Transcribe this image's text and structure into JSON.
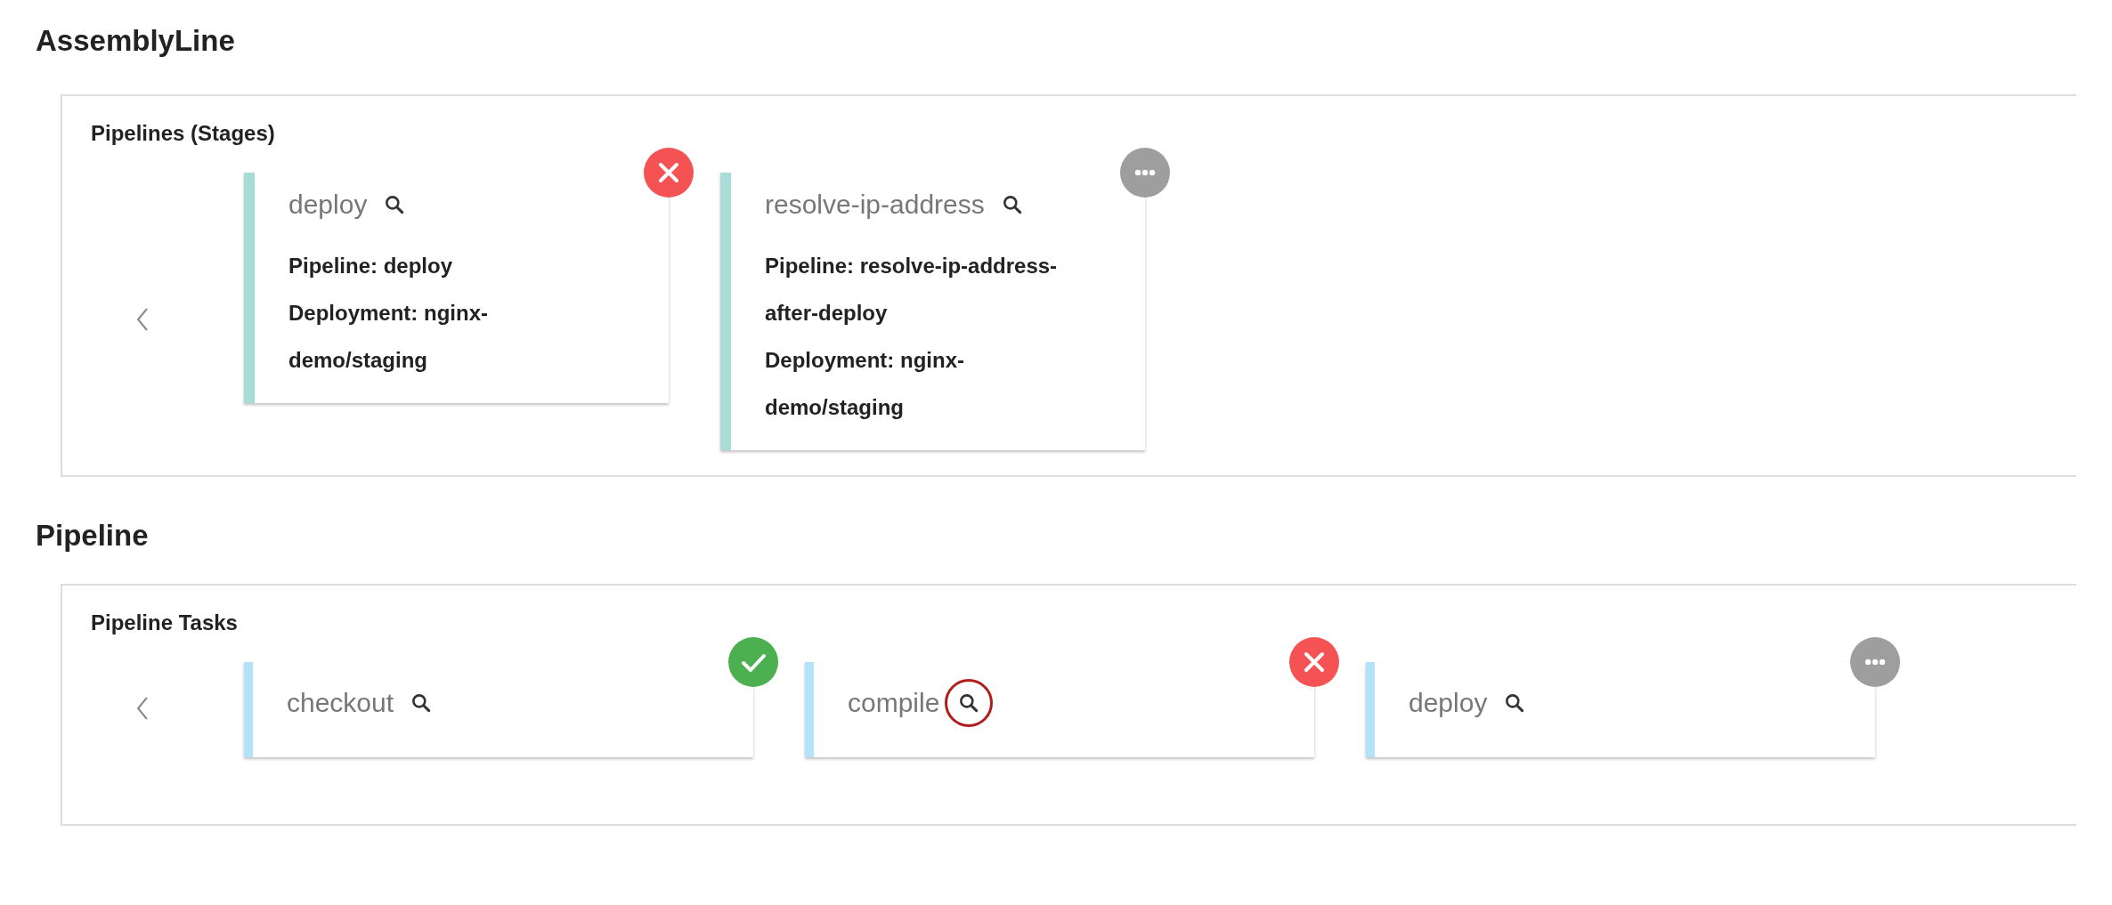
{
  "assembly_line": {
    "title": "AssemblyLine",
    "panel_title": "Pipelines (Stages)",
    "stages": [
      {
        "name": "deploy",
        "kind": "failed",
        "details": [
          "Pipeline: deploy",
          "Deployment: nginx-demo/staging"
        ]
      },
      {
        "name": "resolve-ip-address",
        "kind": "pending",
        "details": [
          "Pipeline: resolve-ip-address-after-deploy",
          "Deployment: nginx-demo/staging"
        ]
      }
    ]
  },
  "pipeline": {
    "title": "Pipeline",
    "panel_title": "Pipeline Tasks",
    "tasks": [
      {
        "name": "checkout",
        "kind": "succeeded",
        "highlighted": false
      },
      {
        "name": "compile",
        "kind": "failed",
        "highlighted": true
      },
      {
        "name": "deploy",
        "kind": "pending",
        "highlighted": false
      }
    ]
  }
}
